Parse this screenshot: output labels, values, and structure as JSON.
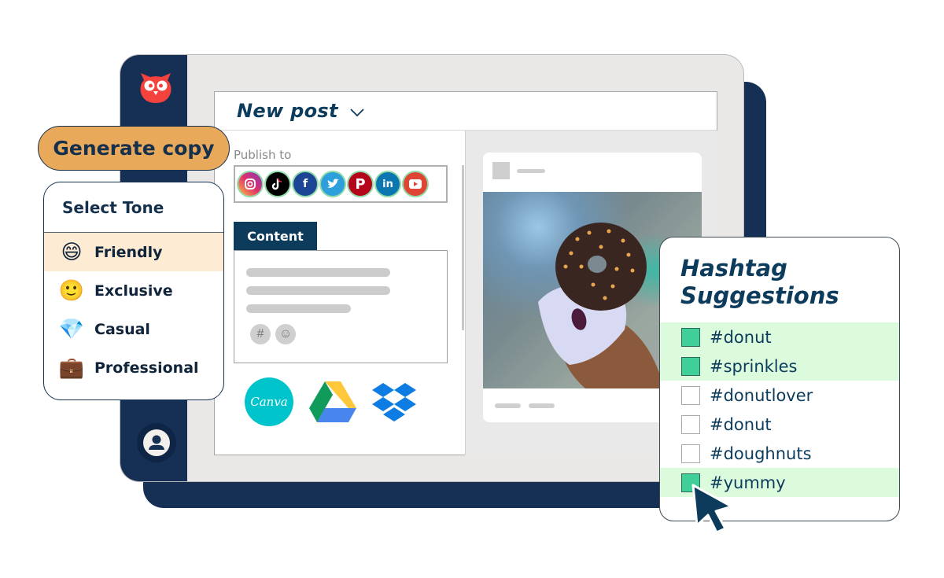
{
  "app": {
    "brand": "owl-logo",
    "panel_title": "New post",
    "title_dropdown_icon": "chevron-down-icon"
  },
  "publish": {
    "label": "Publish to",
    "networks": [
      {
        "name": "Instagram",
        "icon": "instagram-icon",
        "glyph": "◎",
        "color": "#d6306f"
      },
      {
        "name": "TikTok",
        "icon": "tiktok-icon",
        "glyph": "♪",
        "color": "#000000"
      },
      {
        "name": "Facebook",
        "icon": "facebook-icon",
        "glyph": "f",
        "color": "#1d4596"
      },
      {
        "name": "Twitter",
        "icon": "twitter-icon",
        "glyph": "🐦",
        "color": "#2da0db"
      },
      {
        "name": "Pinterest",
        "icon": "pinterest-icon",
        "glyph": "P",
        "color": "#b5051a"
      },
      {
        "name": "LinkedIn",
        "icon": "linkedin-icon",
        "glyph": "in",
        "color": "#0b76b0"
      },
      {
        "name": "YouTube",
        "icon": "youtube-icon",
        "glyph": "▶",
        "color": "#de4534"
      }
    ]
  },
  "content": {
    "tab_label": "Content",
    "hashtag_button": "#",
    "emoji_button": "☺"
  },
  "integrations": {
    "canva_label": "Canva",
    "items": [
      "Canva",
      "Google Drive",
      "Dropbox"
    ]
  },
  "generate": {
    "button_label": "Generate copy"
  },
  "tone": {
    "title": "Select Tone",
    "selected": "Friendly",
    "options": [
      {
        "label": "Friendly",
        "emoji": "😄",
        "icon": "grinning-face-icon"
      },
      {
        "label": "Exclusive",
        "emoji": "🙂",
        "icon": "smiling-face-icon"
      },
      {
        "label": "Casual",
        "emoji": "💎",
        "icon": "gem-icon"
      },
      {
        "label": "Professional",
        "emoji": "💼",
        "icon": "briefcase-icon"
      }
    ]
  },
  "hashtags": {
    "title_line1": "Hashtag",
    "title_line2": "Suggestions",
    "items": [
      {
        "tag": "#donut",
        "checked": true
      },
      {
        "tag": "#sprinkles",
        "checked": true
      },
      {
        "tag": "#donutlover",
        "checked": false
      },
      {
        "tag": "#donut",
        "checked": false
      },
      {
        "tag": "#doughnuts",
        "checked": false
      },
      {
        "tag": "#yummy",
        "checked": true
      }
    ]
  },
  "colors": {
    "navy": "#163055",
    "brand_red": "#f4423d",
    "accent_orange": "#e9a95a",
    "title_blue": "#0c3b5c",
    "check_green": "#40cf98",
    "check_row_bg": "#dcfbdc",
    "selected_tone_bg": "#fdebd3"
  }
}
